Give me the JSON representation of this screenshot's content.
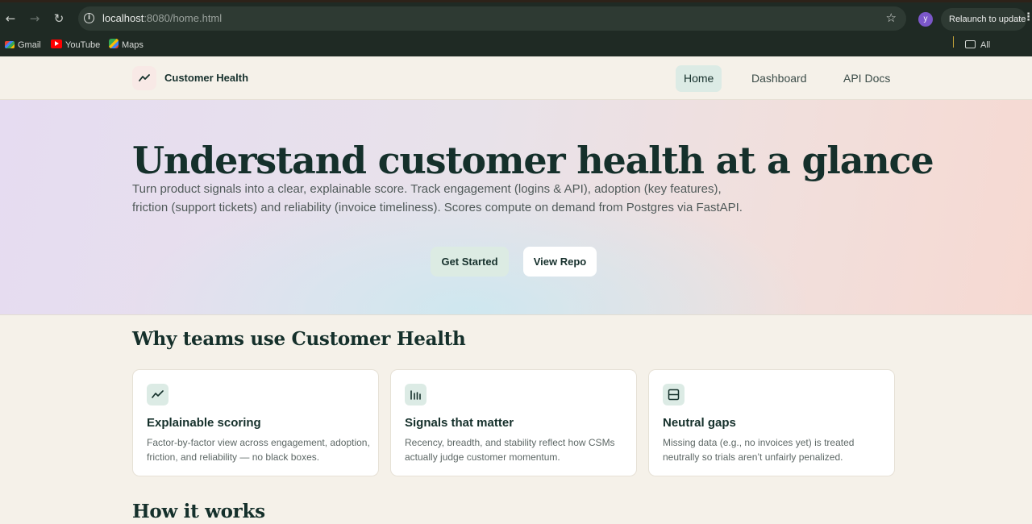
{
  "browser": {
    "url_host": "localhost",
    "url_rest": ":8080/home.html",
    "profile_initial": "y",
    "relaunch_label": "Relaunch to update",
    "bookmarks": [
      {
        "label": "Gmail",
        "icon": "gmail-icon"
      },
      {
        "label": "YouTube",
        "icon": "youtube-icon"
      },
      {
        "label": "Maps",
        "icon": "maps-icon"
      }
    ],
    "all_bookmarks_label": "All Bookmarks"
  },
  "header": {
    "brand": "Customer Health",
    "nav": [
      {
        "label": "Home",
        "active": true
      },
      {
        "label": "Dashboard",
        "active": false
      },
      {
        "label": "API Docs",
        "active": false
      }
    ]
  },
  "hero": {
    "title": "Understand customer health at a glance",
    "subtitle_line1": "Turn product signals into a clear, explainable score. Track engagement (logins & API), adoption (key features),",
    "subtitle_line2": "friction (support tickets) and reliability (invoice timeliness). Scores compute on demand from Postgres via FastAPI.",
    "primary_button": "Get Started",
    "secondary_button": "View Repo"
  },
  "features": {
    "title": "Why teams use Customer Health",
    "cards": [
      {
        "icon": "trend-line-icon",
        "title": "Explainable scoring",
        "desc": "Factor-by-factor view across engagement, adoption, friction, and reliability — no black boxes."
      },
      {
        "icon": "bar-signals-icon",
        "title": "Signals that matter",
        "desc": "Recency, breadth, and stability reflect how CSMs actually judge customer momentum."
      },
      {
        "icon": "panel-icon",
        "title": "Neutral gaps",
        "desc": "Missing data (e.g., no invoices yet) is treated neutrally so trials aren’t unfairly penalized."
      }
    ]
  },
  "how_it_works": {
    "title": "How it works"
  },
  "colors": {
    "accent": "#15302b",
    "accent_soft": "#dcebe5",
    "page_bg": "#f5f1e9"
  }
}
